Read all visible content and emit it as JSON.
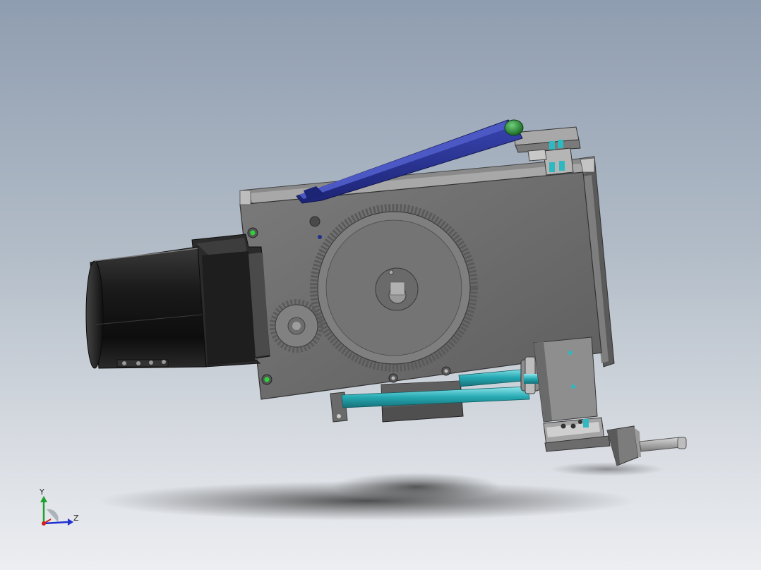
{
  "viewport": {
    "background_top": "#8f9db0",
    "background_bottom": "#eceef1"
  },
  "model": {
    "housing_color": "#6e6e6e",
    "motor_color": "#1c1c1c",
    "arm_color": "#27338f",
    "rod_color": "#2fb8c0",
    "knob_color": "#1f8a2c",
    "gear_color": "#7a7a7a"
  },
  "triad": {
    "y_label": "Y",
    "z_label": "Z",
    "x_color": "#d22020",
    "y_color": "#20a030",
    "z_color": "#2030d0"
  }
}
